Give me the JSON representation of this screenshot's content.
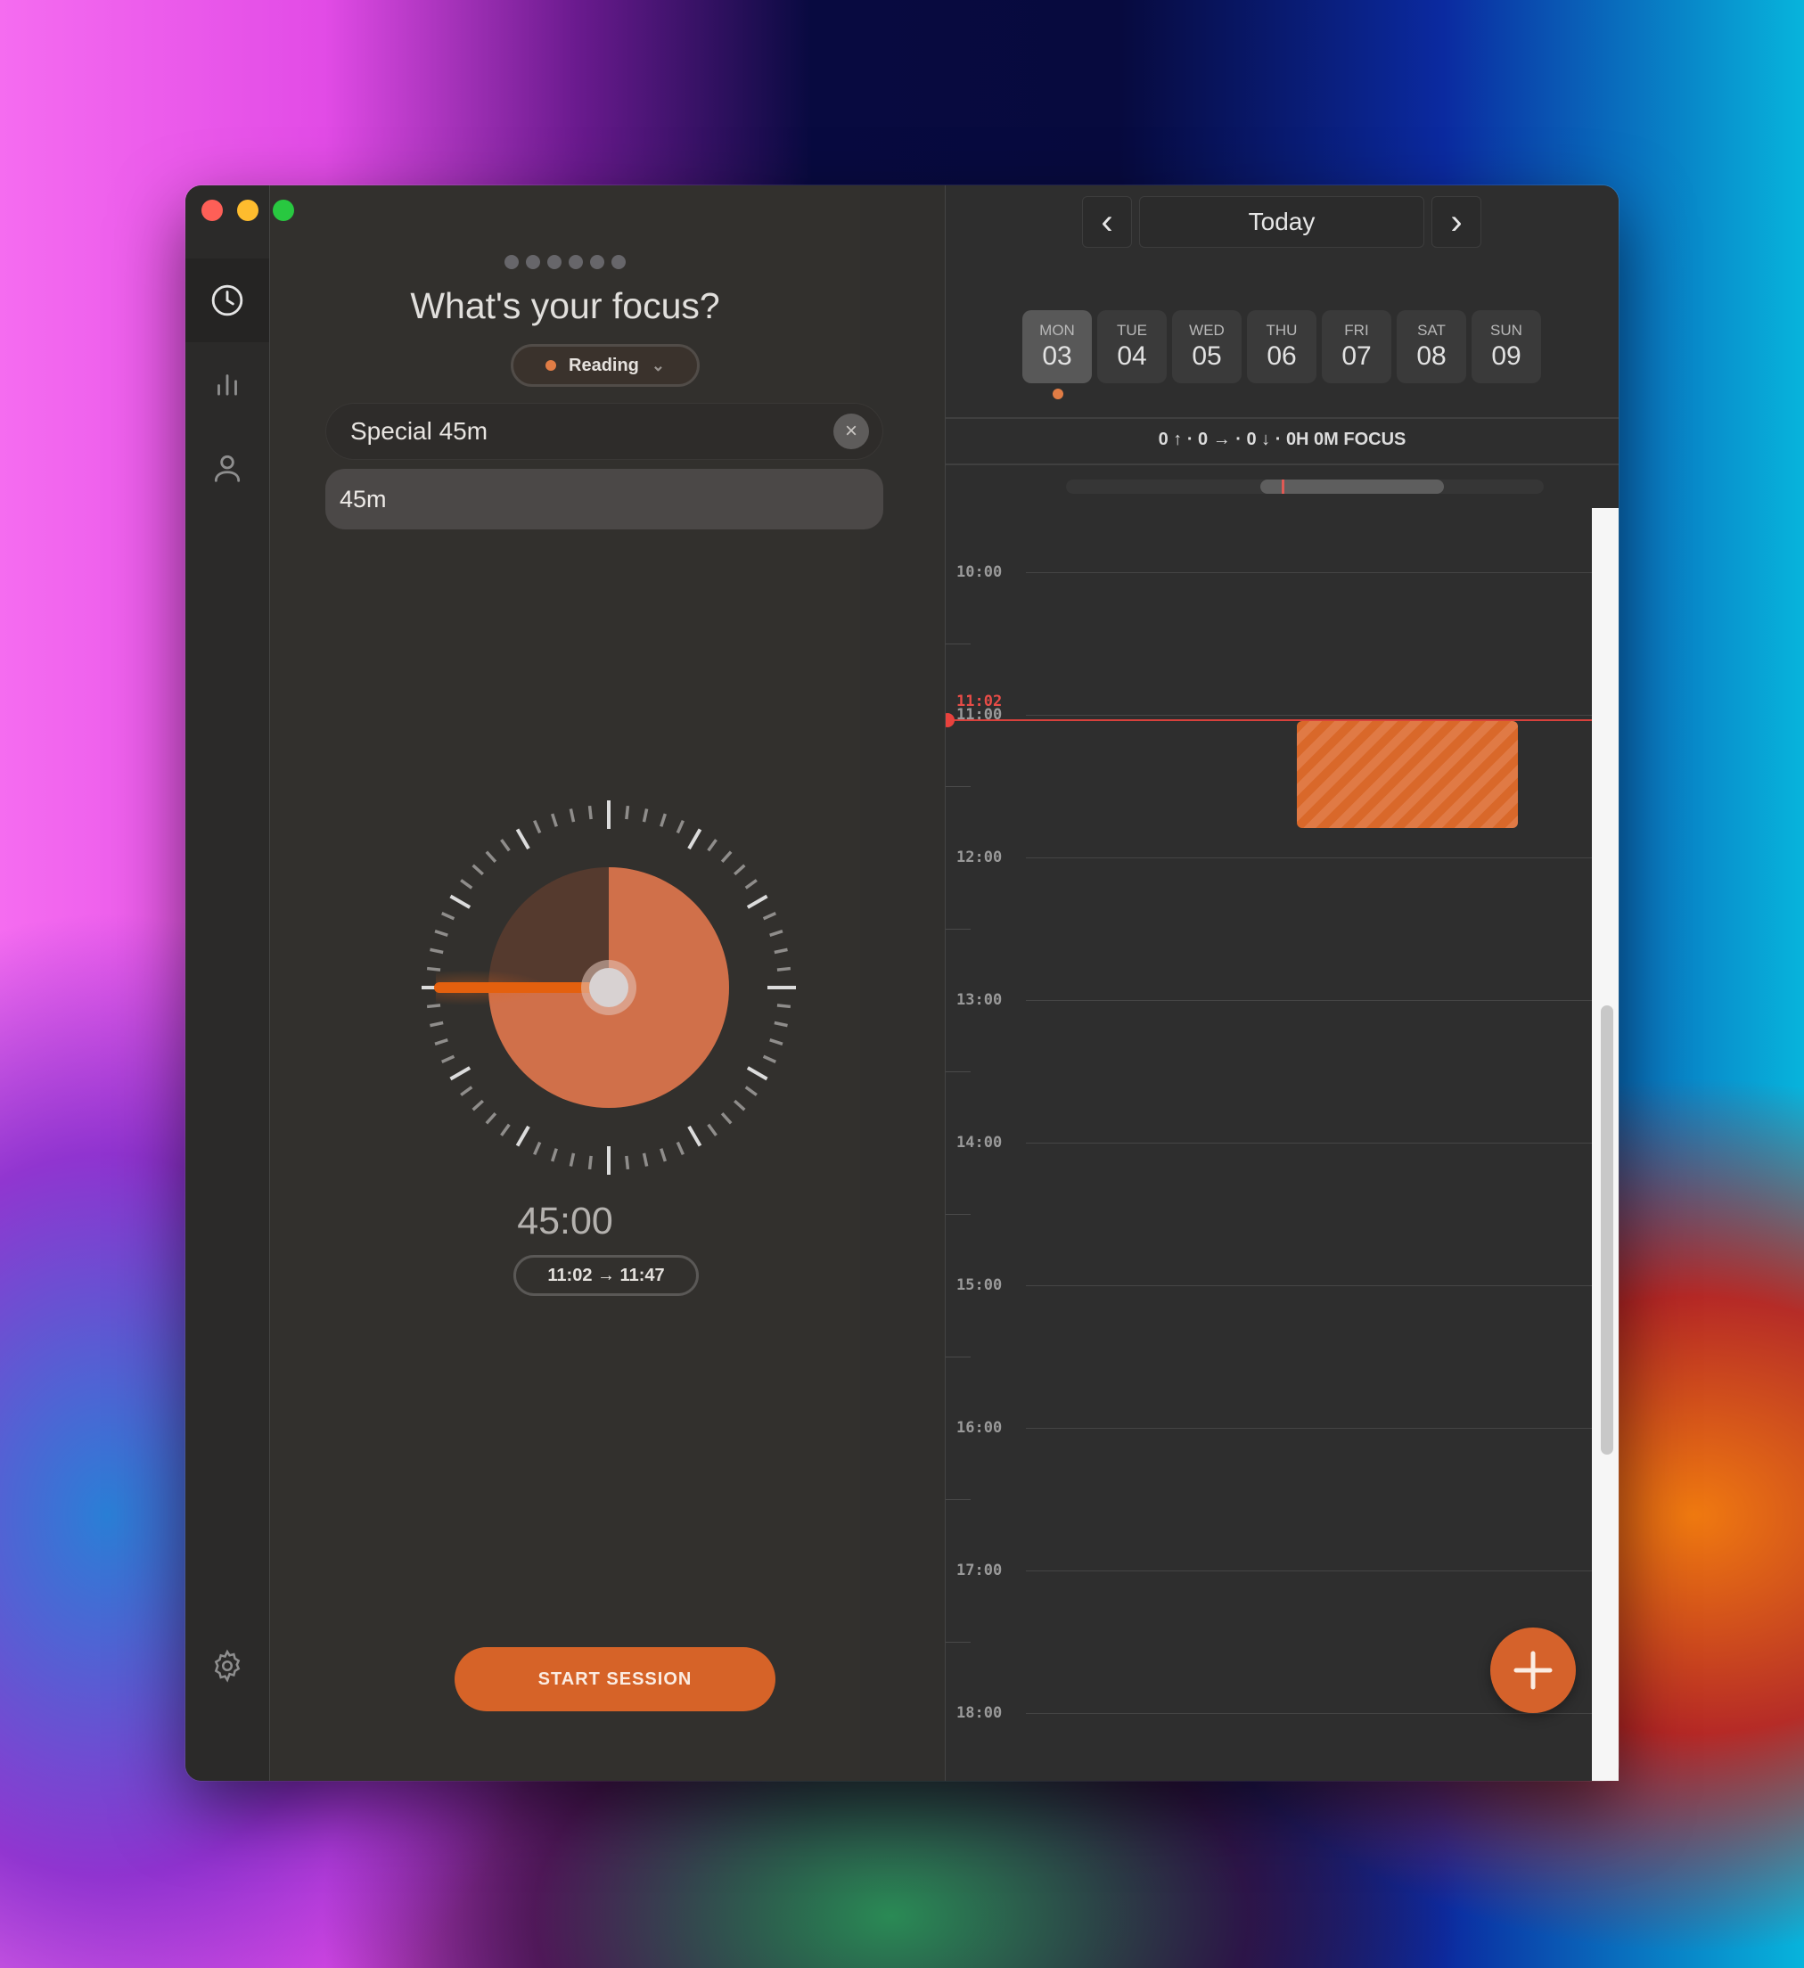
{
  "window": {
    "controls": [
      "close",
      "minimize",
      "zoom"
    ]
  },
  "sidebar": {
    "items": [
      {
        "icon": "clock-icon",
        "label": "Timer",
        "active": true
      },
      {
        "icon": "bar-chart-icon",
        "label": "Stats",
        "active": false
      },
      {
        "icon": "person-icon",
        "label": "Profile",
        "active": false
      }
    ],
    "footer_icon": "gear-icon"
  },
  "focus": {
    "step_dots": 6,
    "title": "What's your focus?",
    "category": {
      "label": "Reading",
      "color": "#e07c45"
    },
    "search": {
      "value": "Special 45m",
      "clear_icon": "×"
    },
    "suggestion": "45m",
    "timer": {
      "duration_minutes": 45,
      "dial_max_minutes": 60,
      "display": "45:00",
      "range": "11:02 → 11:47"
    },
    "start_button": "START SESSION",
    "accent": "#d66328"
  },
  "calendar": {
    "nav": {
      "prev": "‹",
      "label": "Today",
      "next": "›"
    },
    "days": [
      {
        "name": "MON",
        "date": "03",
        "selected": true,
        "has_event": true
      },
      {
        "name": "TUE",
        "date": "04",
        "selected": false
      },
      {
        "name": "WED",
        "date": "05",
        "selected": false
      },
      {
        "name": "THU",
        "date": "06",
        "selected": false
      },
      {
        "name": "FRI",
        "date": "07",
        "selected": false
      },
      {
        "name": "SAT",
        "date": "08",
        "selected": false
      },
      {
        "name": "SUN",
        "date": "09",
        "selected": false
      }
    ],
    "stats": "0 ↑ · 0 → · 0 ↓ · 0H 0M FOCUS",
    "now": {
      "label": "11:02",
      "time_hours": 11.033,
      "color": "#e8423d"
    },
    "hours": [
      "10:00",
      "11:00",
      "12:00",
      "13:00",
      "14:00",
      "15:00",
      "16:00",
      "17:00",
      "18:00"
    ],
    "planned_event": {
      "start": "11:02",
      "end": "11:47",
      "color": "#d9682a"
    },
    "add_button": "+"
  }
}
